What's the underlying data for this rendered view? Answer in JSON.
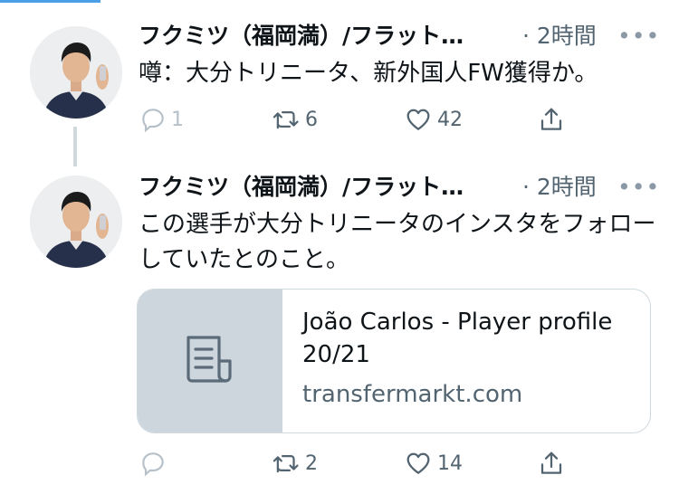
{
  "colors": {
    "accent": "#4a9fe8",
    "text_primary": "#0f1419",
    "text_secondary": "#536471",
    "border": "#cfd9de",
    "card_thumb_bg": "#cdd5dd"
  },
  "tweets": [
    {
      "display_name": "フクミツ（福岡満）/フラット…",
      "time": "· 2時間",
      "more": "•••",
      "text": "噂：大分トリニータ、新外国人FW獲得か。",
      "actions": {
        "reply_count": "1",
        "retweet_count": "6",
        "like_count": "42",
        "icons": [
          "reply-icon",
          "retweet-icon",
          "like-icon",
          "share-icon"
        ]
      }
    },
    {
      "display_name": "フクミツ（福岡満）/フラット…",
      "time": "· 2時間",
      "more": "•••",
      "text": "この選手が大分トリニータのインスタをフォローしていたとのこと。",
      "card": {
        "title": "João Carlos - Player profile 20/21",
        "domain": "transfermarkt.com",
        "icon": "document-icon"
      },
      "actions": {
        "reply_count": "",
        "retweet_count": "2",
        "like_count": "14",
        "icons": [
          "reply-icon",
          "retweet-icon",
          "like-icon",
          "share-icon"
        ]
      }
    }
  ]
}
